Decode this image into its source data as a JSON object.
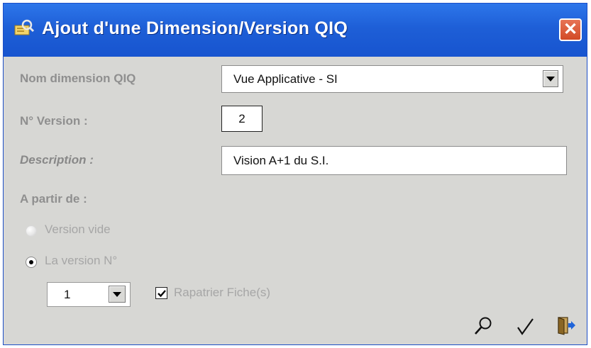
{
  "window": {
    "title": "Ajout d'une Dimension/Version QIQ",
    "close_label": "✕"
  },
  "form": {
    "nom_dimension": {
      "label": "Nom dimension QIQ",
      "value": "Vue Applicative - SI"
    },
    "version": {
      "label": "N° Version :",
      "value": "2"
    },
    "description": {
      "label": "Description :",
      "value": "Vision A+1 du S.I."
    },
    "a_partir_de": {
      "label": "A partir de :",
      "options": [
        {
          "label": "Version vide",
          "selected": false
        },
        {
          "label": "La version N°",
          "selected": true
        }
      ],
      "version_select": {
        "value": "1"
      },
      "rapatrier": {
        "label": "Rapatrier Fiche(s)",
        "checked": true
      }
    }
  },
  "toolbar": {
    "icons": [
      "search-icon",
      "checkmark-icon",
      "exit-door-icon"
    ]
  },
  "colors": {
    "titlebar": "#1e5fd7",
    "window_bg": "#d7d7d4",
    "label": "#8f8f8f",
    "close_button": "#d24a26"
  }
}
